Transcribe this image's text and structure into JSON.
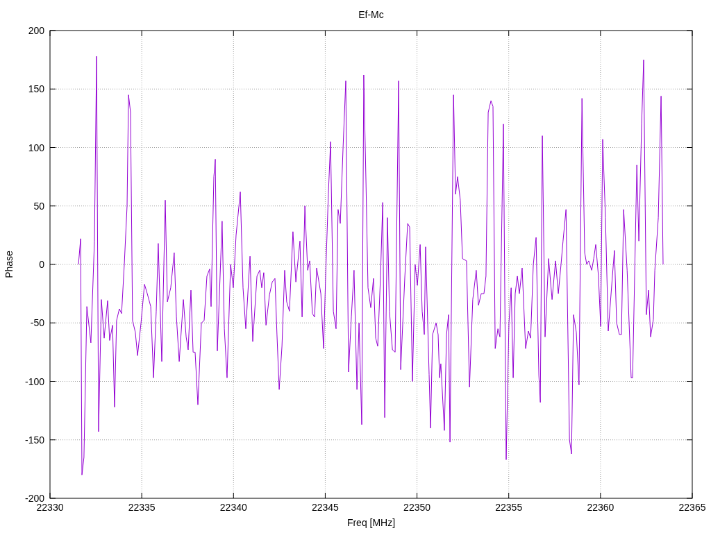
{
  "chart": {
    "chart_data": {
      "type": "line",
      "title": "Ef-Mc",
      "xlabel": "Freq [MHz]",
      "ylabel": "Phase",
      "grid": true,
      "xlim": [
        22330,
        22365
      ],
      "ylim": [
        -200,
        200
      ],
      "xticks": [
        22330,
        22335,
        22340,
        22345,
        22350,
        22355,
        22360,
        22365
      ],
      "yticks": [
        -200,
        -150,
        -100,
        -50,
        0,
        50,
        100,
        150,
        200
      ],
      "x": [
        22331.55,
        22331.67,
        22331.74,
        22331.85,
        22332.01,
        22332.23,
        22332.42,
        22332.54,
        22332.65,
        22332.8,
        22332.95,
        22333.14,
        22333.25,
        22333.41,
        22333.52,
        22333.63,
        22333.78,
        22333.9,
        22334.05,
        22334.2,
        22334.28,
        22334.39,
        22334.5,
        22334.65,
        22334.77,
        22334.96,
        22335.15,
        22335.3,
        22335.49,
        22335.64,
        22335.79,
        22335.9,
        22336.09,
        22336.28,
        22336.4,
        22336.58,
        22336.77,
        22336.89,
        22337.04,
        22337.27,
        22337.42,
        22337.53,
        22337.68,
        22337.8,
        22337.91,
        22338.06,
        22338.25,
        22338.4,
        22338.55,
        22338.7,
        22338.78,
        22338.93,
        22339.01,
        22339.12,
        22339.38,
        22339.5,
        22339.65,
        22339.84,
        22339.99,
        22340.14,
        22340.37,
        22340.52,
        22340.67,
        22340.9,
        22341.05,
        22341.28,
        22341.43,
        22341.54,
        22341.65,
        22341.77,
        22341.96,
        22342.11,
        22342.26,
        22342.37,
        22342.49,
        22342.64,
        22342.79,
        22342.9,
        22343.05,
        22343.24,
        22343.4,
        22343.62,
        22343.74,
        22343.89,
        22344.04,
        22344.15,
        22344.3,
        22344.42,
        22344.53,
        22344.76,
        22344.91,
        22345.02,
        22345.17,
        22345.29,
        22345.44,
        22345.59,
        22345.7,
        22345.82,
        22345.97,
        22346.12,
        22346.27,
        22346.42,
        22346.57,
        22346.73,
        22346.84,
        22346.99,
        22347.1,
        22347.22,
        22347.33,
        22347.48,
        22347.63,
        22347.75,
        22347.86,
        22348.01,
        22348.13,
        22348.24,
        22348.39,
        22348.5,
        22348.66,
        22348.81,
        22349.0,
        22349.11,
        22349.34,
        22349.49,
        22349.6,
        22349.75,
        22349.9,
        22350.02,
        22350.17,
        22350.28,
        22350.4,
        22350.47,
        22350.66,
        22350.74,
        22350.85,
        22351.04,
        22351.15,
        22351.23,
        22351.3,
        22351.49,
        22351.61,
        22351.72,
        22351.8,
        22351.99,
        22352.1,
        22352.21,
        22352.36,
        22352.48,
        22352.7,
        22352.86,
        22353.04,
        22353.23,
        22353.35,
        22353.5,
        22353.65,
        22353.76,
        22353.88,
        22354.03,
        22354.14,
        22354.26,
        22354.41,
        22354.52,
        22354.71,
        22354.86,
        22355.01,
        22355.13,
        22355.24,
        22355.35,
        22355.47,
        22355.58,
        22355.73,
        22355.92,
        22356.07,
        22356.19,
        22356.34,
        22356.49,
        22356.64,
        22356.72,
        22356.83,
        22356.98,
        22357.17,
        22357.36,
        22357.55,
        22357.7,
        22357.85,
        22357.96,
        22358.12,
        22358.31,
        22358.42,
        22358.53,
        22358.68,
        22358.83,
        22358.99,
        22359.14,
        22359.25,
        22359.36,
        22359.52,
        22359.63,
        22359.74,
        22359.89,
        22360.01,
        22360.12,
        22360.27,
        22360.42,
        22360.65,
        22360.76,
        22360.88,
        22361.03,
        22361.14,
        22361.26,
        22361.45,
        22361.67,
        22361.75,
        22361.98,
        22362.09,
        22362.24,
        22362.35,
        22362.5,
        22362.62,
        22362.73,
        22362.88,
        22362.96,
        22363.15,
        22363.3,
        22363.41
      ],
      "series": [
        {
          "color": "#9400d3",
          "values": [
            0,
            22,
            -180,
            -165,
            -36,
            -67,
            20,
            178,
            -143,
            -30,
            -63,
            -31,
            -65,
            -52,
            -122,
            -48,
            -38,
            -42,
            0,
            50,
            145,
            130,
            -48,
            -58,
            -78,
            -50,
            -17,
            -25,
            -36,
            -97,
            -40,
            18,
            -83,
            55,
            -32,
            -20,
            10,
            -45,
            -83,
            -30,
            -62,
            -73,
            -22,
            -75,
            -75,
            -120,
            -50,
            -48,
            -10,
            -4,
            -36,
            75,
            90,
            -74,
            37,
            -55,
            -97,
            0,
            -20,
            25,
            62,
            -20,
            -55,
            7,
            -66,
            -10,
            -5,
            -20,
            -7,
            -52,
            -26,
            -15,
            -12,
            -60,
            -107,
            -70,
            -5,
            -32,
            -40,
            28,
            -15,
            20,
            -45,
            50,
            -5,
            3,
            -42,
            -45,
            -3,
            -25,
            -72,
            -10,
            60,
            105,
            -40,
            -55,
            47,
            35,
            100,
            157,
            -92,
            -45,
            -5,
            -107,
            -50,
            -137,
            162,
            70,
            -20,
            -37,
            -12,
            -63,
            -70,
            -10,
            53,
            -131,
            40,
            -40,
            -73,
            -75,
            157,
            -90,
            -10,
            35,
            32,
            -100,
            0,
            -18,
            17,
            -40,
            -60,
            15,
            -94,
            -140,
            -60,
            -50,
            -60,
            -97,
            -85,
            -142,
            -60,
            -43,
            -152,
            145,
            60,
            75,
            55,
            5,
            3,
            -105,
            -30,
            -5,
            -35,
            -25,
            -25,
            -10,
            130,
            140,
            135,
            -72,
            -55,
            -62,
            120,
            -167,
            -50,
            -20,
            -97,
            -25,
            -10,
            -25,
            -3,
            -72,
            -57,
            -63,
            0,
            23,
            -95,
            -118,
            110,
            -62,
            5,
            -30,
            3,
            -25,
            0,
            20,
            47,
            -150,
            -162,
            -43,
            -58,
            -103,
            142,
            10,
            0,
            3,
            -5,
            5,
            17,
            -10,
            -53,
            107,
            40,
            -57,
            -10,
            12,
            -50,
            -60,
            -60,
            47,
            -5,
            -97,
            -97,
            85,
            20,
            120,
            175,
            -43,
            -22,
            -62,
            -47,
            -5,
            40,
            144,
            0
          ]
        }
      ]
    }
  }
}
